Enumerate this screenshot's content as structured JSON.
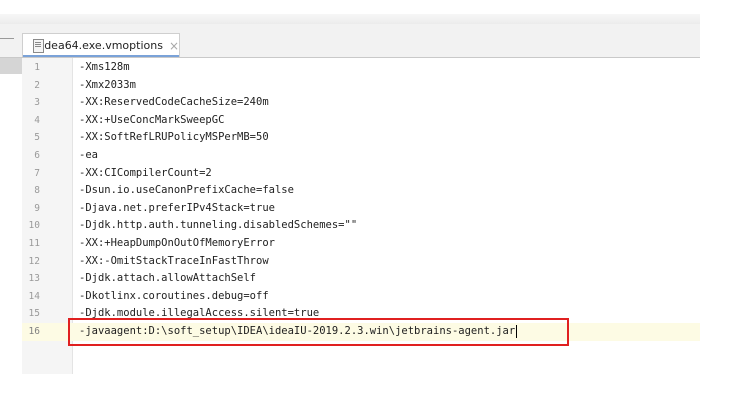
{
  "tab": {
    "filename": "idea64.exe.vmoptions",
    "close_glyph": "×",
    "icon": "file-icon"
  },
  "editor": {
    "current_line": 16,
    "lines": [
      {
        "num": "1",
        "text": "-Xms128m"
      },
      {
        "num": "2",
        "text": "-Xmx2033m"
      },
      {
        "num": "3",
        "text": "-XX:ReservedCodeCacheSize=240m"
      },
      {
        "num": "4",
        "text": "-XX:+UseConcMarkSweepGC"
      },
      {
        "num": "5",
        "text": "-XX:SoftRefLRUPolicyMSPerMB=50"
      },
      {
        "num": "6",
        "text": "-ea"
      },
      {
        "num": "7",
        "text": "-XX:CICompilerCount=2"
      },
      {
        "num": "8",
        "text": "-Dsun.io.useCanonPrefixCache=false"
      },
      {
        "num": "9",
        "text": "-Djava.net.preferIPv4Stack=true"
      },
      {
        "num": "10",
        "text": "-Djdk.http.auth.tunneling.disabledSchemes=\"\""
      },
      {
        "num": "11",
        "text": "-XX:+HeapDumpOnOutOfMemoryError"
      },
      {
        "num": "12",
        "text": "-XX:-OmitStackTraceInFastThrow"
      },
      {
        "num": "13",
        "text": "-Djdk.attach.allowAttachSelf"
      },
      {
        "num": "14",
        "text": "-Dkotlinx.coroutines.debug=off"
      },
      {
        "num": "15",
        "text": "-Djdk.module.illegalAccess.silent=true"
      },
      {
        "num": "16",
        "text": "-javaagent:D:\\soft_setup\\IDEA\\ideaIU-2019.2.3.win\\jetbrains-agent.jar"
      }
    ]
  },
  "colors": {
    "highlight_box": "#e02020",
    "current_line_bg": "#fdfbe4",
    "tab_underline": "#7aa2d8"
  }
}
